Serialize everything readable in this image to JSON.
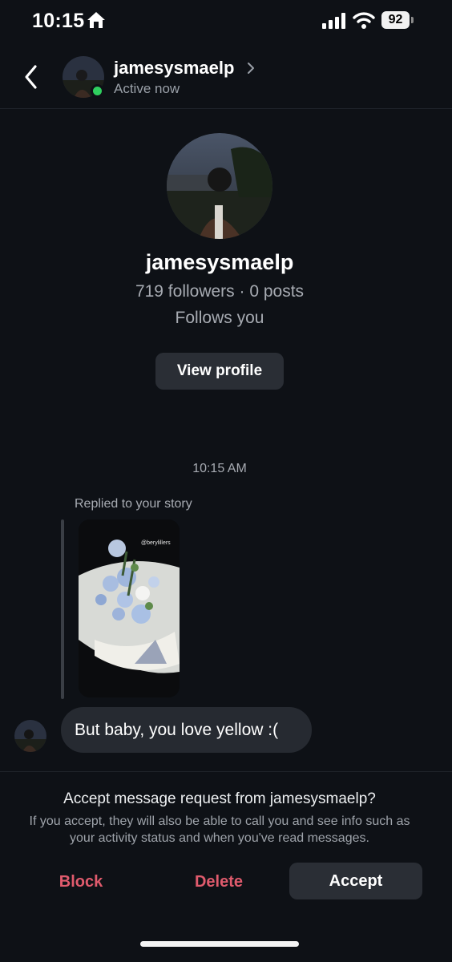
{
  "status_bar": {
    "time": "10:15",
    "battery": "92",
    "icons": [
      "home-icon",
      "signal-icon",
      "wifi-icon",
      "battery-icon"
    ]
  },
  "header": {
    "username": "jamesysmaelp",
    "status": "Active now",
    "icons": [
      "back-icon",
      "chevron-right-icon"
    ],
    "online_color": "#2fcf5f"
  },
  "profile": {
    "username": "jamesysmaelp",
    "stats": "719 followers · 0 posts",
    "follows": "Follows you",
    "view_profile_label": "View profile"
  },
  "conversation": {
    "timestamp": "10:15 AM",
    "replied_label": "Replied to your story",
    "story_tag": "@berylillers",
    "message": "But baby, you love yellow :("
  },
  "request": {
    "title": "Accept message request from jamesysmaelp?",
    "description": "If you accept, they will also be able to call you and see info such as your activity status and when you've read messages.",
    "block_label": "Block",
    "delete_label": "Delete",
    "accept_label": "Accept",
    "danger_color": "#e05b6d"
  }
}
